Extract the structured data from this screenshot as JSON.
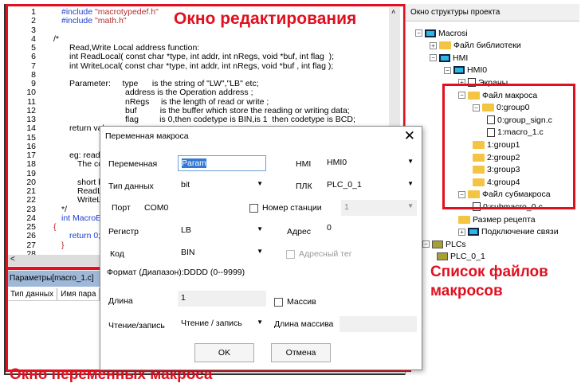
{
  "editor": {
    "line_numbers": [
      "1",
      "2",
      "3",
      "4",
      "5",
      "6",
      "7",
      "8",
      "9",
      "10",
      "11",
      "12",
      "13",
      "14",
      "15",
      "16",
      "17",
      "18",
      "19",
      "20",
      "21",
      "22",
      "23",
      "24",
      "25",
      "26",
      "27",
      "28"
    ],
    "lines": [
      {
        "n": 1,
        "indent": 1,
        "cls": "kw",
        "text": "#include ",
        "str": "\"macrotypedef.h\""
      },
      {
        "n": 2,
        "indent": 1,
        "cls": "kw",
        "text": "#include ",
        "str": "\"math.h\""
      },
      {
        "n": 4,
        "indent": 0,
        "text": "/*"
      },
      {
        "n": 5,
        "indent": 2,
        "text": "Read,Write Local address function:"
      },
      {
        "n": 6,
        "indent": 2,
        "text": "int ReadLocal( const char *type, int addr, int nRegs, void *buf, int flag  );"
      },
      {
        "n": 7,
        "indent": 2,
        "text": "int WriteLocal( const char *type, int addr, int nRegs, void *buf , int flag );"
      },
      {
        "n": 9,
        "indent": 2,
        "text": "Parameter:     type      is the string of \"LW\",\"LB\" etc;"
      },
      {
        "n": 10,
        "indent": 9,
        "text": "address is the Operation address ;"
      },
      {
        "n": 11,
        "indent": 9,
        "text": "nRegs     is the length of read or write ;"
      },
      {
        "n": 12,
        "indent": 9,
        "text": "buf          is the buffer which store the reading or writing data;"
      },
      {
        "n": 13,
        "indent": 9,
        "text": "flag         is 0,then codetype is BIN,is 1  then codetype is BCD;"
      },
      {
        "n": 14,
        "indent": 2,
        "text": "return val"
      },
      {
        "n": 17,
        "indent": 2,
        "text": "eg: read t"
      },
      {
        "n": 18,
        "indent": 3,
        "text": "The cod"
      },
      {
        "n": 20,
        "indent": 3,
        "text": "short bu"
      },
      {
        "n": 21,
        "indent": 3,
        "text": "ReadLo"
      },
      {
        "n": 22,
        "indent": 3,
        "text": "WriteLo"
      },
      {
        "n": 23,
        "indent": 1,
        "text": "*/"
      },
      {
        "n": 24,
        "indent": 1,
        "cls": "kw",
        "text": "int MacroEnt"
      },
      {
        "n": 25,
        "indent": 0,
        "cls": "str",
        "text": "{"
      },
      {
        "n": 26,
        "indent": 2,
        "cls": "kw",
        "text": "return 0;"
      },
      {
        "n": 27,
        "indent": 1,
        "cls": "str",
        "text": "}"
      }
    ]
  },
  "annotations": {
    "edit_window": "Окно редактирования",
    "macro_list": "Список файлов макросов",
    "var_window": "Окно переменных макроса"
  },
  "tree": {
    "title": "Окно структуры проекта",
    "items": [
      {
        "label": "Macrosi",
        "level": 0,
        "icon": "project",
        "exp": "-"
      },
      {
        "label": "Файл библиотеки",
        "level": 1,
        "icon": "folder",
        "exp": "+"
      },
      {
        "label": "HMI",
        "level": 1,
        "icon": "monitor",
        "exp": "-"
      },
      {
        "label": "HMI0",
        "level": 2,
        "icon": "monitor",
        "exp": "-"
      },
      {
        "label": "Экраны",
        "level": 3,
        "icon": "screen",
        "exp": "+"
      },
      {
        "label": "Файл макроса",
        "level": 3,
        "icon": "folder",
        "exp": "-"
      },
      {
        "label": "0:group0",
        "level": 4,
        "icon": "folder",
        "exp": "-"
      },
      {
        "label": "0:group_sign.c",
        "level": 5,
        "icon": "file"
      },
      {
        "label": "1:macro_1.c",
        "level": 5,
        "icon": "file"
      },
      {
        "label": "1:group1",
        "level": 4,
        "icon": "folder"
      },
      {
        "label": "2:group2",
        "level": 4,
        "icon": "folder"
      },
      {
        "label": "3:group3",
        "level": 4,
        "icon": "folder"
      },
      {
        "label": "4:group4",
        "level": 4,
        "icon": "folder"
      },
      {
        "label": "Файл субмакроса",
        "level": 3,
        "icon": "folder",
        "exp": "-"
      },
      {
        "label": "0:submacro_0.c",
        "level": 4,
        "icon": "file"
      },
      {
        "label": "Размер рецепта",
        "level": 3,
        "icon": "folder"
      },
      {
        "label": "Подключение связи",
        "level": 3,
        "icon": "monitor",
        "exp": "+"
      },
      {
        "label": "PLCs",
        "level": 0.5,
        "icon": "plc",
        "exp": "-"
      },
      {
        "label": "PLC_0_1",
        "level": 1.5,
        "icon": "plc"
      }
    ]
  },
  "params": {
    "title": "Параметры[macro_1.c]",
    "columns": [
      "Тип данных",
      "Имя пара"
    ]
  },
  "dialog": {
    "title": "Переменная макроса",
    "variable_label": "Переменная",
    "variable_value": "Param",
    "hmi_label": "HMI",
    "hmi_value": "HMI0",
    "datatype_label": "Тип данных",
    "datatype_value": "bit",
    "plc_label": "ПЛК",
    "plc_value": "PLC_0_1",
    "port_label": "Порт",
    "port_value": "COM0",
    "station_label": "Номер станции",
    "station_value": "1",
    "register_label": "Регистр",
    "register_value": "LB",
    "address_label": "Адрес",
    "address_value": "0",
    "code_label": "Код",
    "code_value": "BIN",
    "addr_tag_label": "Адресный тег",
    "format_text": "Формат (Диапазон):DDDD (0--9999)",
    "length_label": "Длина",
    "length_value": "1",
    "array_label": "Массив",
    "rw_label": "Чтение/запись",
    "rw_value": "Чтение / запись",
    "array_len_label": "Длина массива",
    "ok": "OK",
    "cancel": "Отмена"
  }
}
